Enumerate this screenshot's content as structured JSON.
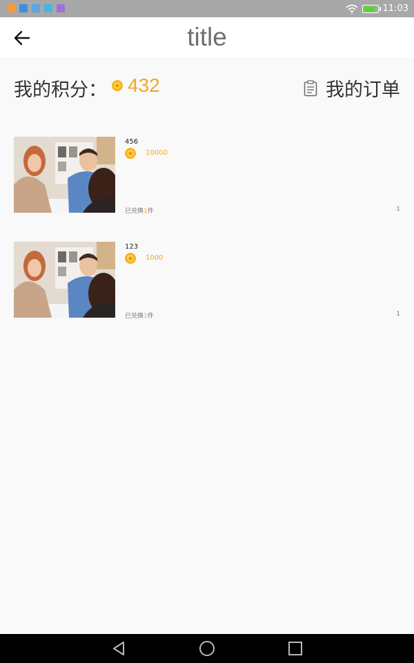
{
  "status_bar": {
    "time": "11:03",
    "icons": [
      "app-icon-1",
      "app-icon-2",
      "app-icon-3",
      "app-icon-4",
      "app-icon-5",
      "wifi-icon",
      "battery-icon"
    ]
  },
  "header": {
    "title": "title",
    "back_icon": "back-arrow-icon"
  },
  "points": {
    "label": "我的积分：",
    "value": "432",
    "coin_icon": "coin-icon",
    "orders_label": "我的订单",
    "orders_icon": "clipboard-icon"
  },
  "products": [
    {
      "name": "456",
      "price": "10000",
      "exchanged_prefix": "已兑换",
      "exchanged_count": "1",
      "exchanged_suffix": "件",
      "qty": "1"
    },
    {
      "name": "123",
      "price": "1000",
      "exchanged_prefix": "已兑换",
      "exchanged_count": "1",
      "exchanged_suffix": "件",
      "qty": "1"
    }
  ],
  "colors": {
    "accent": "#f5a623",
    "status_bar": "#a8a8a8",
    "background": "#f9f9f9",
    "header_bg": "#ffffff",
    "nav_bar": "#000000"
  },
  "nav": {
    "icons": [
      "back-triangle-icon",
      "home-circle-icon",
      "recents-square-icon"
    ]
  }
}
